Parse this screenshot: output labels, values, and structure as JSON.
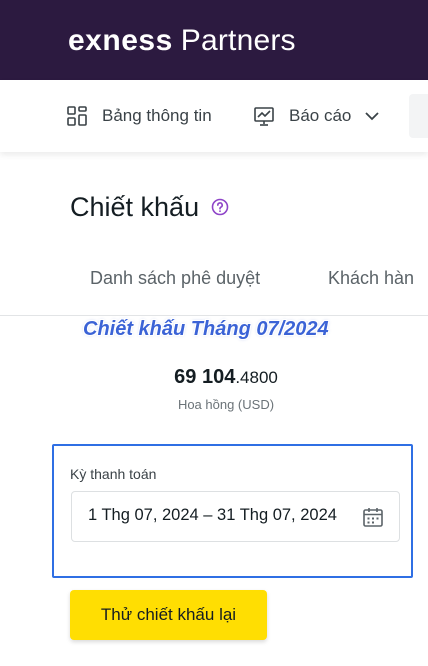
{
  "header": {
    "brand": "exness",
    "brand_suffix": "Partners"
  },
  "nav": {
    "dashboard_label": "Bảng thông tin",
    "reports_label": "Báo cáo"
  },
  "page": {
    "title": "Chiết khấu"
  },
  "tabs": [
    {
      "label": "Danh sách phê duyệt"
    },
    {
      "label": "Khách hàn"
    }
  ],
  "overlay": {
    "caption": "Chiết khấu Tháng 07/2024"
  },
  "summary": {
    "amount_integer": "69 104",
    "amount_decimal": ".4800",
    "amount_label": "Hoa hồng (USD)"
  },
  "period": {
    "label": "Kỳ thanh toán",
    "value": "1 Thg 07, 2024 – 31 Thg 07, 2024"
  },
  "actions": {
    "retry_label": "Thử chiết khấu lại"
  },
  "colors": {
    "header_bg": "#2c1a40",
    "accent_yellow": "#ffde02",
    "focus_blue": "#2f6fe4",
    "help_purple": "#8e44c8",
    "overlay_blue": "#3b63d6"
  }
}
